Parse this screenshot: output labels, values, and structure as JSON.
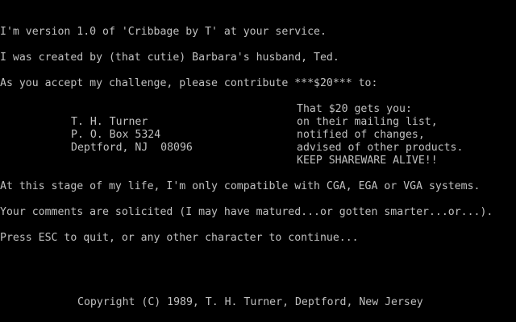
{
  "intro": {
    "version_line": "I'm version 1.0 of 'Cribbage by T' at your service.",
    "creator_line": "I was created by (that cutie) Barbara's husband, Ted.",
    "challenge_line": "As you accept my challenge, please contribute ***$20*** to:"
  },
  "address": {
    "name": "T. H. Turner",
    "po_box": "P. O. Box 5324",
    "city": "Deptford, NJ  08096"
  },
  "benefits": {
    "heading": "That $20 gets you:",
    "items": [
      "on their mailing list,",
      "notified of changes,",
      "advised of other products."
    ],
    "slogan": "KEEP SHAREWARE ALIVE!!"
  },
  "info": {
    "compat_line": "At this stage of my life, I'm only compatible with CGA, EGA or VGA systems.",
    "comments_line": "Your comments are solicited (I may have matured...or gotten smarter...or...).",
    "prompt_line": "Press ESC to quit, or any other character to continue..."
  },
  "footer": {
    "copyright": "Copyright (C) 1989, T. H. Turner, Deptford, New Jersey"
  },
  "colors": {
    "background": "#000000",
    "text": "#c0c0c0"
  }
}
